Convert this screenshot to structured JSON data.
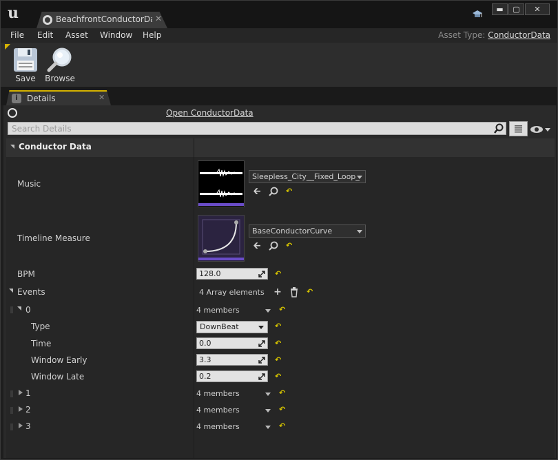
{
  "window": {
    "tab_title": "BeachfrontConductorData",
    "buttons": {
      "minimize": "▬",
      "maximize": "▢",
      "close": "✕"
    }
  },
  "menu": {
    "items": [
      "File",
      "Edit",
      "Asset",
      "Window",
      "Help"
    ],
    "asset_type_label": "Asset Type:",
    "asset_type_value": "ConductorData"
  },
  "toolbar": {
    "save_label": "Save",
    "browse_label": "Browse"
  },
  "details": {
    "tab_label": "Details",
    "open_link": "Open ConductorData",
    "search_placeholder": "Search Details",
    "category": "Conductor Data",
    "music_label": "Music",
    "music_asset": "Sleepless_City__Fixed_Loop_",
    "timeline_label": "Timeline Measure",
    "timeline_asset": "BaseConductorCurve",
    "bpm_label": "BPM",
    "bpm_value": "128.0",
    "events_label": "Events",
    "events_count": "4 Array elements",
    "event0": {
      "index": "0",
      "members": "4 members",
      "type_label": "Type",
      "type_value": "DownBeat",
      "time_label": "Time",
      "time_value": "0.0",
      "early_label": "Window Early",
      "early_value": "3.3",
      "late_label": "Window Late",
      "late_value": "0.2"
    },
    "event1": {
      "index": "1",
      "members": "4 members"
    },
    "event2": {
      "index": "2",
      "members": "4 members"
    },
    "event3": {
      "index": "3",
      "members": "4 members"
    },
    "reset_glyph": "↶"
  },
  "colors": {
    "accent": "#d6b300",
    "reset": "#d6c400",
    "curve_bg": "#2b2340"
  }
}
